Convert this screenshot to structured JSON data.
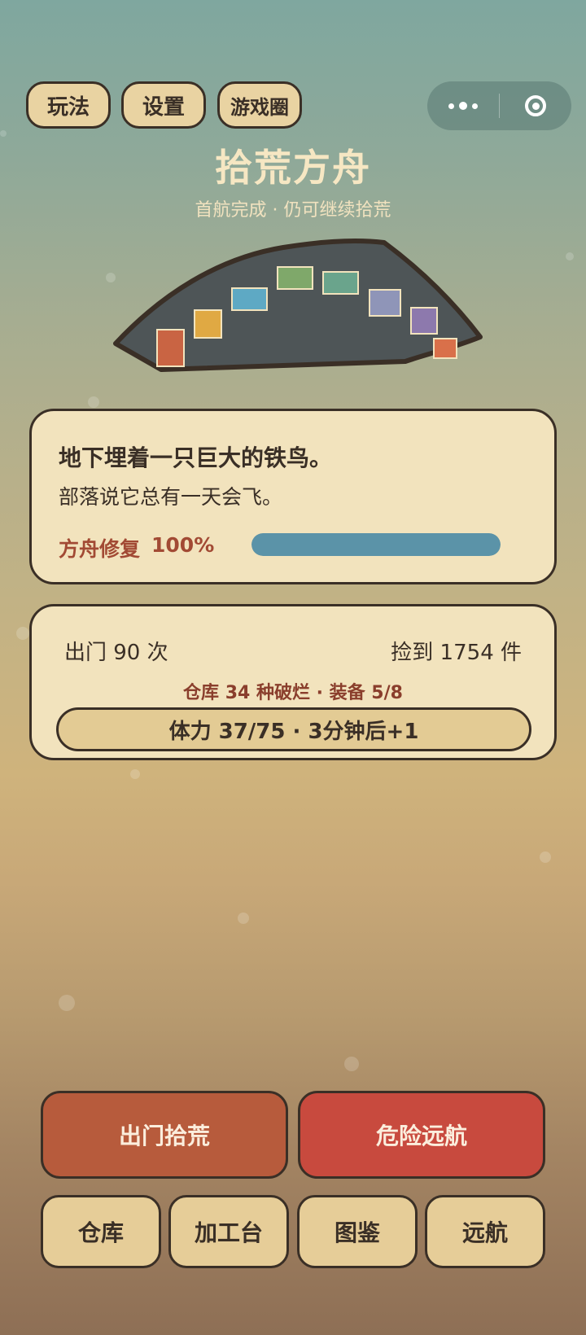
{
  "top_buttons": {
    "play": "玩法",
    "settings": "设置",
    "game_circle": "游戏圈"
  },
  "header": {
    "title": "拾荒方舟",
    "subtitle": "首航完成 · 仍可继续拾荒"
  },
  "ark": {
    "hull_color": "#4e5557",
    "panel_colors": [
      "#c96443",
      "#e0a943",
      "#5ea9c4",
      "#7fa86a",
      "#6aa48c",
      "#8f95b8",
      "#8d79ad",
      "#d9704a"
    ]
  },
  "story": {
    "title": "地下埋着一只巨大的铁鸟。",
    "text": "部落说它总有一天会飞。",
    "repair_label": "方舟修复",
    "repair_percent_text": "100%",
    "repair_progress": 1.0
  },
  "stats": {
    "trips": "出门 90 次",
    "found": "捡到 1754 件",
    "inventory": "仓库 34 种破烂 · 装备 5/8",
    "stamina": "体力 37/75 · 3分钟后+1"
  },
  "actions": {
    "scavenge": "出门拾荒",
    "voyage": "危险远航",
    "warehouse": "仓库",
    "workbench": "加工台",
    "catalog": "图鉴",
    "expedition": "远航"
  },
  "colors": {
    "accent_red": "#c84a3e",
    "accent_orange": "#b75b3c",
    "card_bg": "#f2e3bd",
    "progress_blue": "#5b93a8",
    "outline": "#3a2f26"
  }
}
